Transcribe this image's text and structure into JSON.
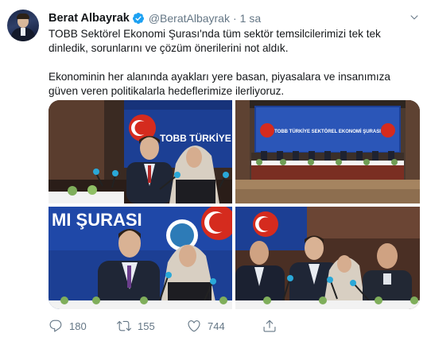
{
  "tweet": {
    "author_name": "Berat Albayrak",
    "handle": "@BeratAlbayrak",
    "separator": "·",
    "time": "1 sa",
    "text_p1": "TOBB Sektörel Ekonomi Şurası'nda tüm sektör temsilcilerimizi tek tek dinledik, sorunlarını ve çözüm önerilerini not aldık.",
    "text_p2": "Ekonominin her alanında ayakları yere basan, piyasalara ve insanımıza güven veren politikalarla hedeflerimize ilerliyoruz.",
    "photos": [
      {
        "banner_text": "TOBB TÜRKİYE SEKT"
      },
      {
        "banner_text": "TOBB TÜRKİYE SEKTÖREL EKONOMİ ŞURASI"
      },
      {
        "banner_text": "MI ŞURASI"
      },
      {
        "banner_text": ""
      }
    ],
    "stats": {
      "replies": "180",
      "retweets": "155",
      "likes": "744"
    }
  },
  "icons": {
    "verified": "verified-badge-icon",
    "caret": "chevron-down-icon",
    "reply": "reply-icon",
    "retweet": "retweet-icon",
    "like": "heart-icon",
    "share": "share-icon"
  },
  "colors": {
    "text": "#14171a",
    "secondary": "#657786",
    "verified_blue": "#1da1f2",
    "banner_blue": "#1c3f94",
    "tobb_red": "#d52b1e"
  }
}
